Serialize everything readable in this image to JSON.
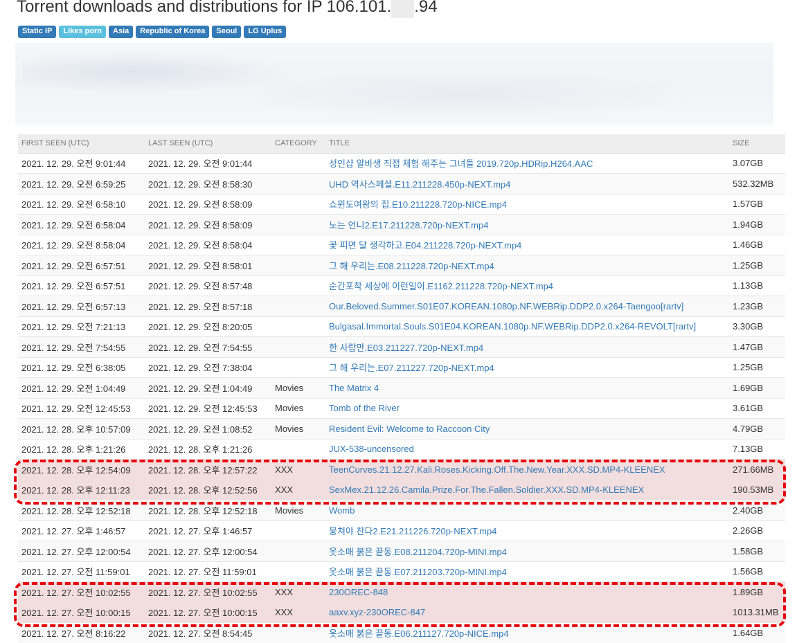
{
  "page": {
    "title_prefix": "Torrent downloads and distributions for IP 106.101.",
    "title_suffix": ".94"
  },
  "tags": [
    {
      "label": "Static IP",
      "style": "dark"
    },
    {
      "label": "Likes porn",
      "style": "light"
    },
    {
      "label": "Asia",
      "style": "dark"
    },
    {
      "label": "Republic of Korea",
      "style": "dark"
    },
    {
      "label": "Seoul",
      "style": "dark"
    },
    {
      "label": "LG Uplus",
      "style": "dark"
    }
  ],
  "table": {
    "headers": {
      "first_seen": "FIRST SEEN (UTC)",
      "last_seen": "LAST SEEN (UTC)",
      "category": "CATEGORY",
      "title": "TITLE",
      "size": "SIZE"
    },
    "rows": [
      {
        "first": "2021. 12. 29. 오전 9:01:44",
        "last": "2021. 12. 29. 오전 9:01:44",
        "category": "",
        "title": "성인샵 알바생 직접 체험 해주는 그녀들 2019.720p.HDRip.H264.AAC",
        "size": "3.07GB",
        "flagged": false
      },
      {
        "first": "2021. 12. 29. 오전 6:59:25",
        "last": "2021. 12. 29. 오전 8:58:30",
        "category": "",
        "title": "UHD 역사스페셜.E11.211228.450p-NEXT.mp4",
        "size": "532.32MB",
        "flagged": false
      },
      {
        "first": "2021. 12. 29. 오전 6:58:10",
        "last": "2021. 12. 29. 오전 8:58:09",
        "category": "",
        "title": "쇼윈도여왕의 집.E10.211228.720p-NICE.mp4",
        "size": "1.57GB",
        "flagged": false
      },
      {
        "first": "2021. 12. 29. 오전 6:58:04",
        "last": "2021. 12. 29. 오전 8:58:09",
        "category": "",
        "title": "노는 언니2.E17.211228.720p-NEXT.mp4",
        "size": "1.94GB",
        "flagged": false
      },
      {
        "first": "2021. 12. 29. 오전 8:58:04",
        "last": "2021. 12. 29. 오전 8:58:04",
        "category": "",
        "title": "꽃 피면 달 생각하고.E04.211228.720p-NEXT.mp4",
        "size": "1.46GB",
        "flagged": false
      },
      {
        "first": "2021. 12. 29. 오전 6:57:51",
        "last": "2021. 12. 29. 오전 8:58:01",
        "category": "",
        "title": "그 해 우리는.E08.211228.720p-NEXT.mp4",
        "size": "1.25GB",
        "flagged": false
      },
      {
        "first": "2021. 12. 29. 오전 6:57:51",
        "last": "2021. 12. 29. 오전 8:57:48",
        "category": "",
        "title": "순간포착 세상에 이런일이.E1162.211228.720p-NEXT.mp4",
        "size": "1.13GB",
        "flagged": false
      },
      {
        "first": "2021. 12. 29. 오전 6:57:13",
        "last": "2021. 12. 29. 오전 8:57:18",
        "category": "",
        "title": "Our.Beloved.Summer.S01E07.KOREAN.1080p.NF.WEBRip.DDP2.0.x264-Taengoo[rartv]",
        "size": "1.23GB",
        "flagged": false
      },
      {
        "first": "2021. 12. 29. 오전 7:21:13",
        "last": "2021. 12. 29. 오전 8:20:05",
        "category": "",
        "title": "Bulgasal.Immortal.Souls.S01E04.KOREAN.1080p.NF.WEBRip.DDP2.0.x264-REVOLT[rartv]",
        "size": "3.30GB",
        "flagged": false
      },
      {
        "first": "2021. 12. 29. 오전 7:54:55",
        "last": "2021. 12. 29. 오전 7:54:55",
        "category": "",
        "title": "한 사람만.E03.211227.720p-NEXT.mp4",
        "size": "1.47GB",
        "flagged": false
      },
      {
        "first": "2021. 12. 29. 오전 6:38:05",
        "last": "2021. 12. 29. 오전 7:38:04",
        "category": "",
        "title": "그 해 우리는.E07.211227.720p-NEXT.mp4",
        "size": "1.25GB",
        "flagged": false
      },
      {
        "first": "2021. 12. 29. 오전 1:04:49",
        "last": "2021. 12. 29. 오전 1:04:49",
        "category": "Movies",
        "title": "The Matrix 4",
        "size": "1.69GB",
        "flagged": false
      },
      {
        "first": "2021. 12. 29. 오전 12:45:53",
        "last": "2021. 12. 29. 오전 12:45:53",
        "category": "Movies",
        "title": "Tomb of the River",
        "size": "3.61GB",
        "flagged": false
      },
      {
        "first": "2021. 12. 28. 오후 10:57:09",
        "last": "2021. 12. 29. 오전 1:08:52",
        "category": "Movies",
        "title": "Resident Evil: Welcome to Raccoon City",
        "size": "4.79GB",
        "flagged": false
      },
      {
        "first": "2021. 12. 28. 오후 1:21:26",
        "last": "2021. 12. 28. 오후 1:21:26",
        "category": "",
        "title": "JUX-538-uncensored",
        "size": "7.13GB",
        "flagged": false
      },
      {
        "first": "2021. 12. 28. 오후 12:54:09",
        "last": "2021. 12. 28. 오후 12:57:22",
        "category": "XXX",
        "title": "TeenCurves.21.12.27.Kali.Roses.Kicking.Off.The.New.Year.XXX.SD.MP4-KLEENEX",
        "size": "271.66MB",
        "flagged": true
      },
      {
        "first": "2021. 12. 28. 오후 12:11:23",
        "last": "2021. 12. 28. 오후 12:52:56",
        "category": "XXX",
        "title": "SexMex.21.12.26.Camila.Prize.For.The.Fallen.Soldier.XXX.SD.MP4-KLEENEX",
        "size": "190.53MB",
        "flagged": true
      },
      {
        "first": "2021. 12. 28. 오후 12:52:18",
        "last": "2021. 12. 28. 오후 12:52:18",
        "category": "Movies",
        "title": "Womb",
        "size": "2.40GB",
        "flagged": false
      },
      {
        "first": "2021. 12. 27. 오후 1:46:57",
        "last": "2021. 12. 27. 오후 1:46:57",
        "category": "",
        "title": "뭉쳐야 찬다2.E21.211226.720p-NEXT.mp4",
        "size": "2.26GB",
        "flagged": false
      },
      {
        "first": "2021. 12. 27. 오후 12:00:54",
        "last": "2021. 12. 27. 오후 12:00:54",
        "category": "",
        "title": "옷소매 붉은 끝동.E08.211204.720p-MINI.mp4",
        "size": "1.58GB",
        "flagged": false
      },
      {
        "first": "2021. 12. 27. 오전 11:59:01",
        "last": "2021. 12. 27. 오전 11:59:01",
        "category": "",
        "title": "옷소매 붉은 끝동.E07.211203.720p-MINI.mp4",
        "size": "1.56GB",
        "flagged": false
      },
      {
        "first": "2021. 12. 27. 오전 10:02:55",
        "last": "2021. 12. 27. 오전 10:02:55",
        "category": "XXX",
        "title": "230OREC-848",
        "size": "1.89GB",
        "flagged": true
      },
      {
        "first": "2021. 12. 27. 오전 10:00:15",
        "last": "2021. 12. 27. 오전 10:00:15",
        "category": "XXX",
        "title": "aaxv.xyz-230OREC-847",
        "size": "1013.31MB",
        "flagged": true
      },
      {
        "first": "2021. 12. 27. 오전 8:16:22",
        "last": "2021. 12. 27. 오전 8:54:45",
        "category": "",
        "title": "옷소매 붉은 끝동.E06.211127.720p-NICE.mp4",
        "size": "1.64GB",
        "flagged": false
      }
    ]
  },
  "colors": {
    "link": "#337ab7",
    "badge_dark": "#337ab7",
    "badge_light": "#5bc0de",
    "highlight_row": "#f2dede",
    "annotation_outline": "#e8000a"
  }
}
